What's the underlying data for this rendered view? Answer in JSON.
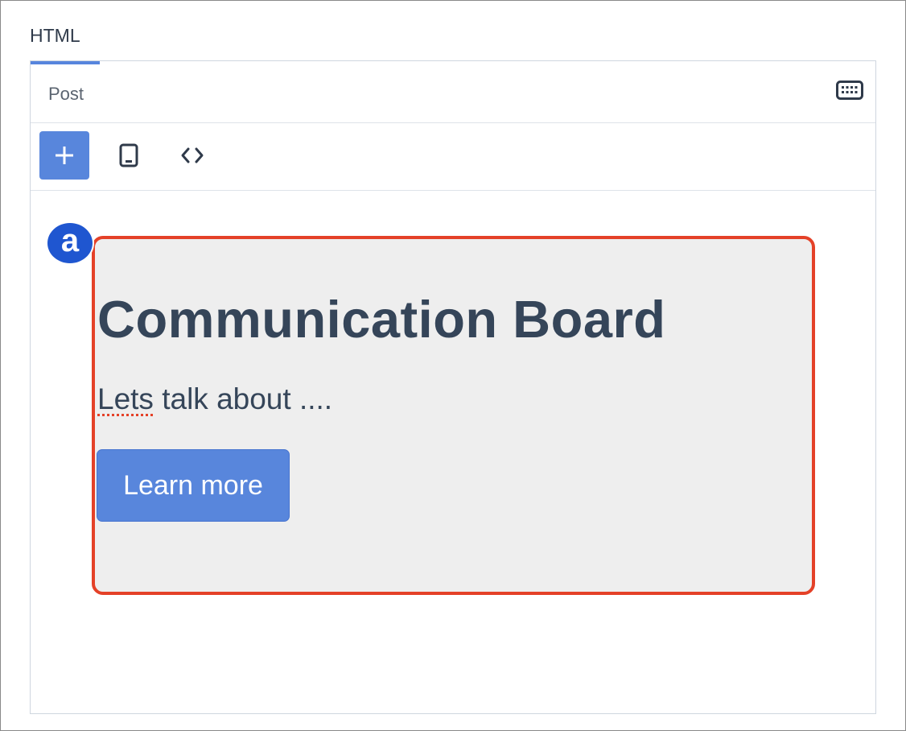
{
  "field": {
    "label": "HTML"
  },
  "editor": {
    "tab": {
      "label": "Post"
    },
    "icons": {
      "keyboard": "keyboard-icon",
      "add": "plus-icon",
      "preview": "tablet-icon",
      "code": "code-icon"
    },
    "colors": {
      "accent": "#5886dc",
      "selection_border": "#e44128",
      "badge": "#1f56d0",
      "block_bg": "#eeeeee",
      "text": "#354559"
    }
  },
  "block": {
    "badge": "a",
    "title": "Communication Board",
    "text_misspelled": "Lets",
    "text_rest": " talk about ....",
    "button_label": "Learn more"
  }
}
